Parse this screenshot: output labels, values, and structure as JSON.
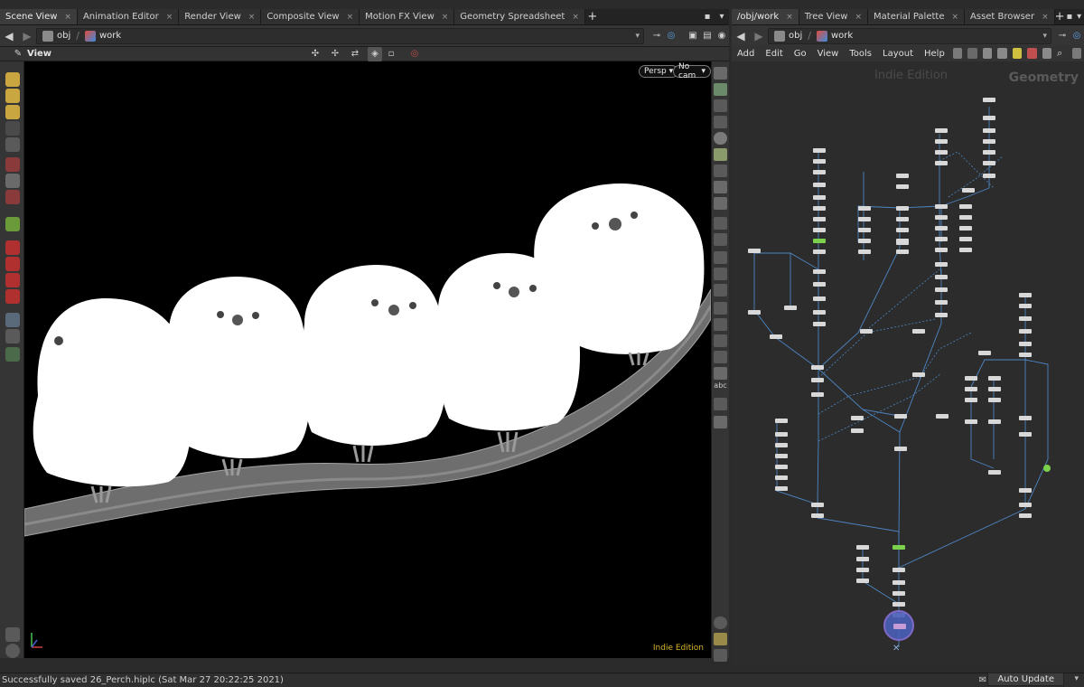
{
  "left_tabs": [
    {
      "label": "Scene View",
      "active": true
    },
    {
      "label": "Animation Editor",
      "active": false
    },
    {
      "label": "Render View",
      "active": false
    },
    {
      "label": "Composite View",
      "active": false
    },
    {
      "label": "Motion FX View",
      "active": false
    },
    {
      "label": "Geometry Spreadsheet",
      "active": false
    }
  ],
  "right_tabs": [
    {
      "label": "/obj/work",
      "active": true
    },
    {
      "label": "Tree View",
      "active": false
    },
    {
      "label": "Material Palette",
      "active": false
    },
    {
      "label": "Asset Browser",
      "active": false
    }
  ],
  "tab_close": "×",
  "tab_add": "+",
  "left_path": {
    "root": "obj",
    "current": "work"
  },
  "right_path": {
    "root": "obj",
    "current": "work"
  },
  "viewer": {
    "title": "View",
    "camera_persp": "Persp",
    "camera_cam": "No cam",
    "watermark": "Indie Edition"
  },
  "network": {
    "menu": [
      "Add",
      "Edit",
      "Go",
      "View",
      "Tools",
      "Layout",
      "Help"
    ],
    "watermark": "Indie Edition",
    "context_label": "Geometry"
  },
  "status": {
    "message": "Successfully saved 26_Perch.hiplc (Sat Mar 27 20:22:25 2021)",
    "auto_update": "Auto Update"
  },
  "colors": {
    "accent_green": "#7bd14b",
    "highlight_purple": "#8a6fd6",
    "link_blue": "#4d86c4",
    "watermark_yellow": "#d9b628"
  }
}
